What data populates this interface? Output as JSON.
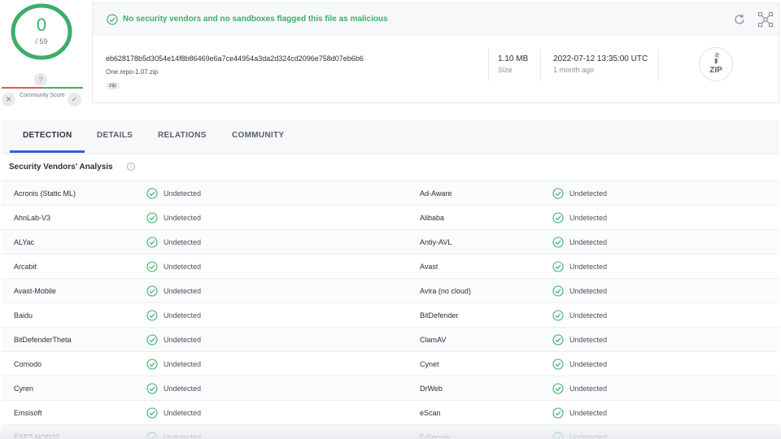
{
  "score": {
    "detections": "0",
    "total": "/ 59",
    "community_label": "Community Score",
    "help_symbol": "?",
    "colors": {
      "clean": "#3cae6b",
      "malicious": "#e05a5a"
    }
  },
  "verdict": {
    "text": "No security vendors and no sandboxes flagged this file as malicious",
    "icon": "check-circle-icon"
  },
  "file": {
    "hash": "eb628178b5d3054e14f8b86469e6a7ce44954a3da2d324cd2096e758d07eb6b6",
    "name": "One.repo-1.07.zip",
    "tag": "zip",
    "size_value": "1.10 MB",
    "size_label": "Size",
    "date_value": "2022-07-12 13:35:00 UTC",
    "date_label": "1 month ago",
    "type_badge": "ZIP"
  },
  "tabs": [
    {
      "label": "DETECTION",
      "active": true
    },
    {
      "label": "DETAILS",
      "active": false
    },
    {
      "label": "RELATIONS",
      "active": false
    },
    {
      "label": "COMMUNITY",
      "active": false
    }
  ],
  "section_title": "Security Vendors' Analysis",
  "vendors": [
    {
      "left": "Acronis (Static ML)",
      "left_result": "Undetected",
      "right": "Ad-Aware",
      "right_result": "Undetected"
    },
    {
      "left": "AhnLab-V3",
      "left_result": "Undetected",
      "right": "Alibaba",
      "right_result": "Undetected"
    },
    {
      "left": "ALYac",
      "left_result": "Undetected",
      "right": "Antiy-AVL",
      "right_result": "Undetected"
    },
    {
      "left": "Arcabit",
      "left_result": "Undetected",
      "right": "Avast",
      "right_result": "Undetected"
    },
    {
      "left": "Avast-Mobile",
      "left_result": "Undetected",
      "right": "Avira (no cloud)",
      "right_result": "Undetected"
    },
    {
      "left": "Baidu",
      "left_result": "Undetected",
      "right": "BitDefender",
      "right_result": "Undetected"
    },
    {
      "left": "BitDefenderTheta",
      "left_result": "Undetected",
      "right": "ClamAV",
      "right_result": "Undetected"
    },
    {
      "left": "Comodo",
      "left_result": "Undetected",
      "right": "Cynet",
      "right_result": "Undetected"
    },
    {
      "left": "Cyren",
      "left_result": "Undetected",
      "right": "DrWeb",
      "right_result": "Undetected"
    },
    {
      "left": "Emsisoft",
      "left_result": "Undetected",
      "right": "eScan",
      "right_result": "Undetected"
    },
    {
      "left": "ESET-NOD32",
      "left_result": "Undetected",
      "right": "F-Secure",
      "right_result": "Undetected"
    }
  ]
}
